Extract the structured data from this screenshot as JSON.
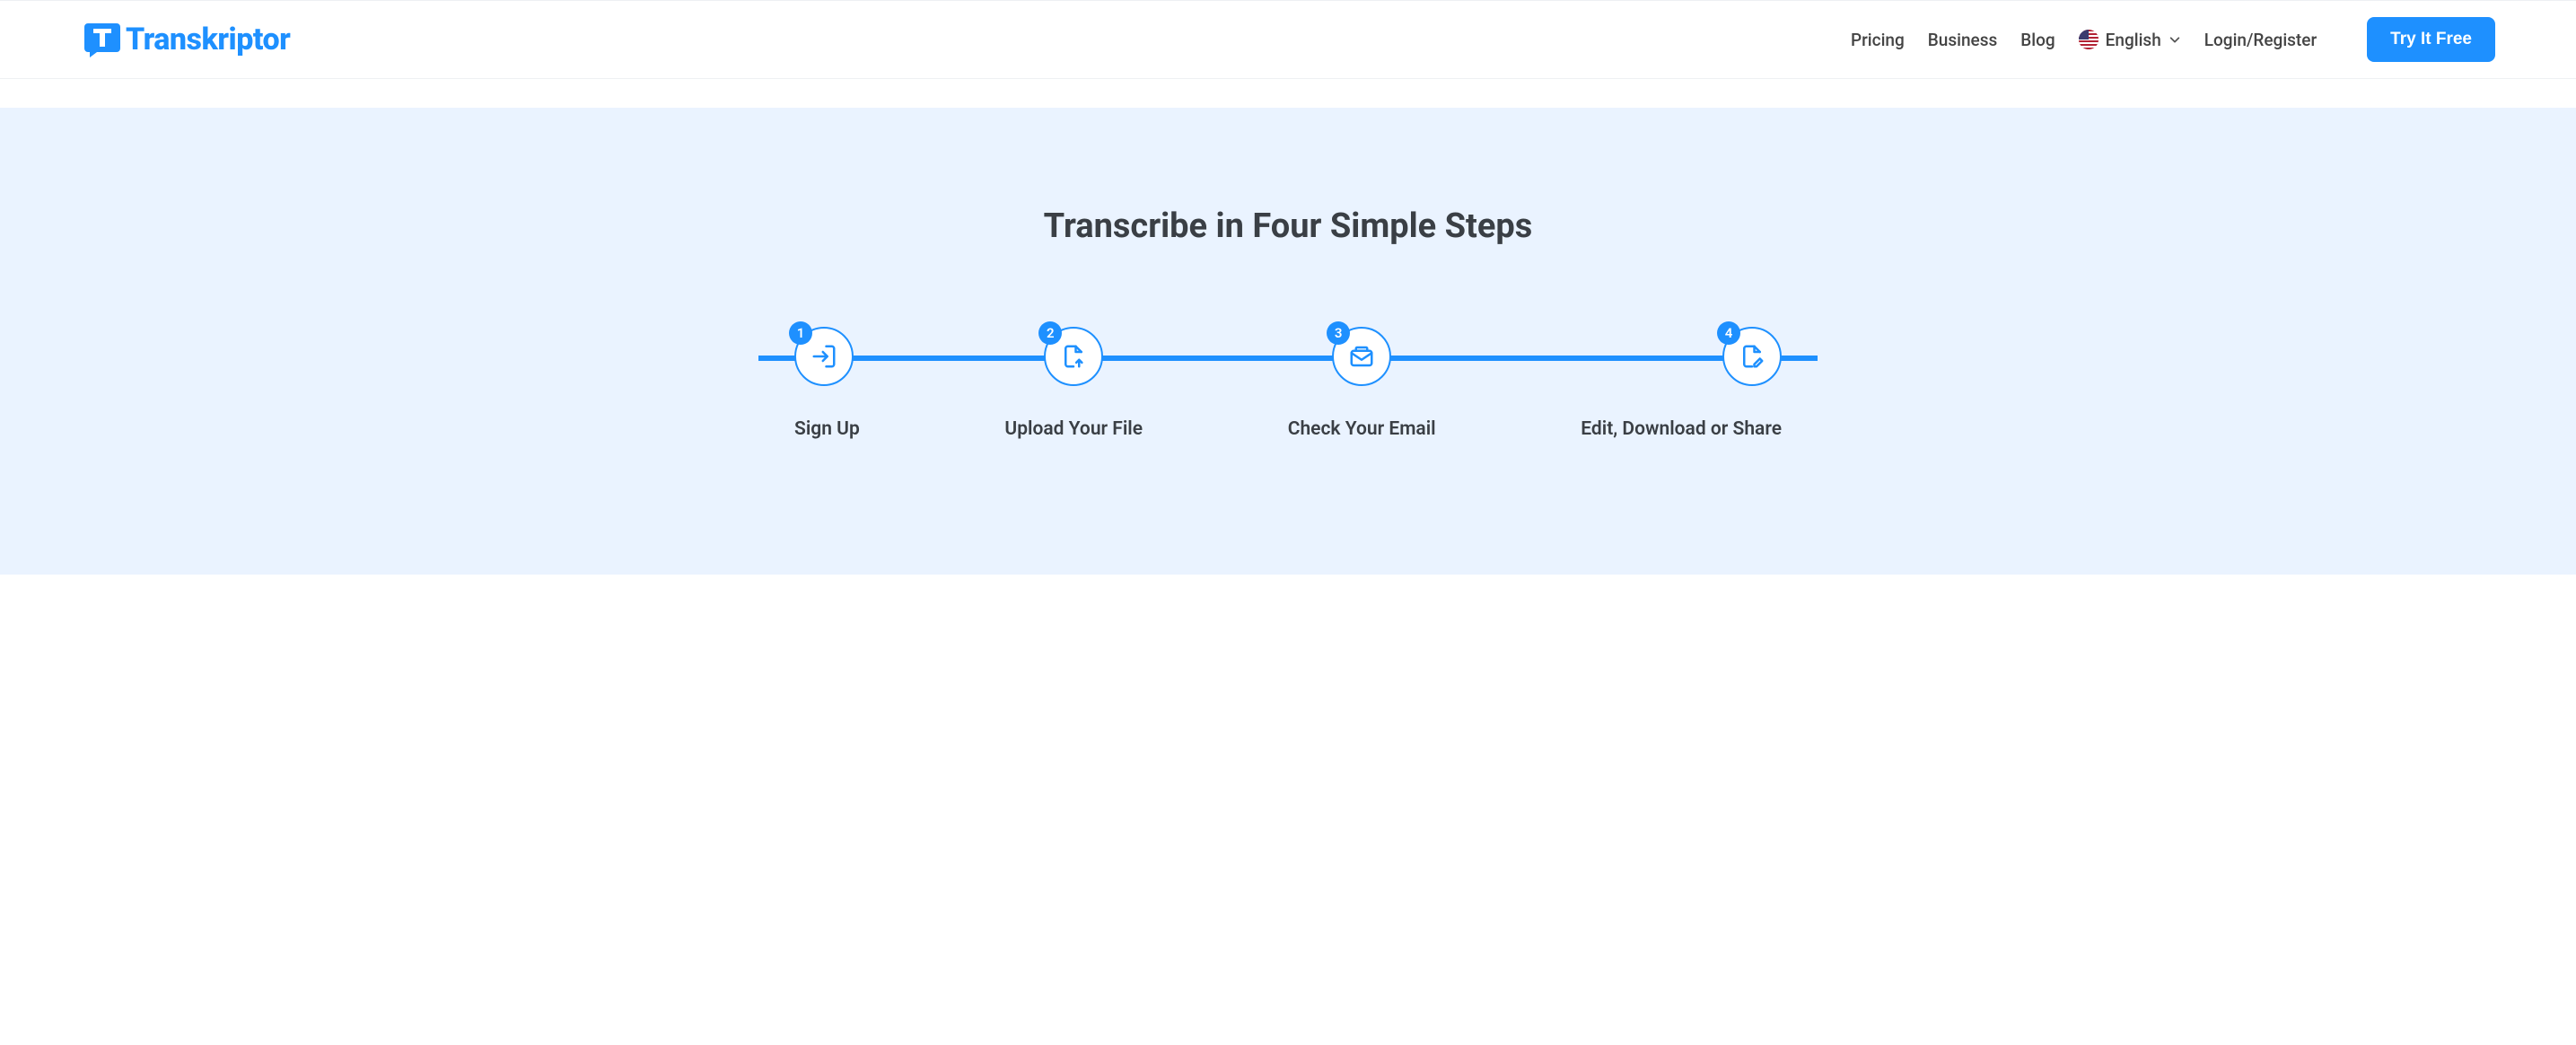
{
  "brand": {
    "name": "Transkriptor"
  },
  "nav": {
    "pricing": "Pricing",
    "business": "Business",
    "blog": "Blog",
    "language_label": "English",
    "login": "Login/Register",
    "cta": "Try It Free"
  },
  "hero": {
    "title": "Transcribe in Four Simple Steps"
  },
  "steps": [
    {
      "num": "1",
      "label": "Sign Up"
    },
    {
      "num": "2",
      "label": "Upload Your File"
    },
    {
      "num": "3",
      "label": "Check Your Email"
    },
    {
      "num": "4",
      "label": "Edit, Download or Share"
    }
  ]
}
